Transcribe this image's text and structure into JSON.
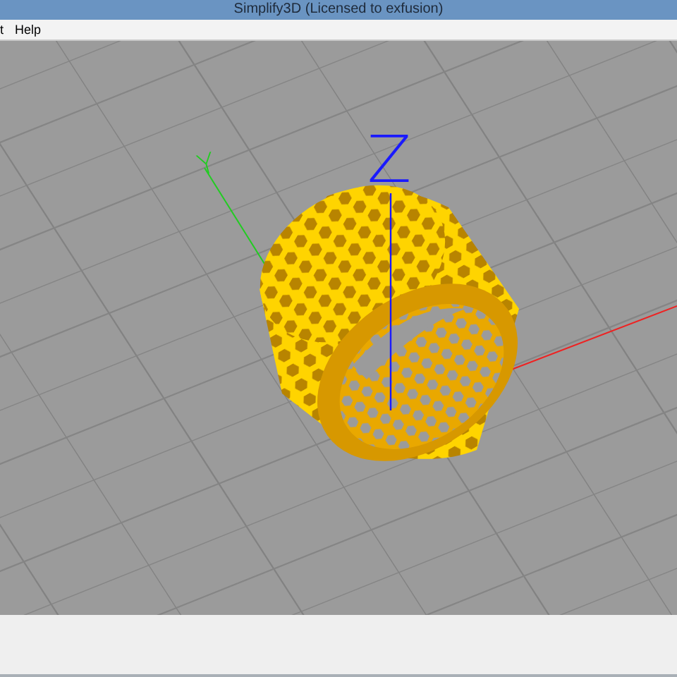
{
  "window": {
    "title": "Simplify3D (Licensed to exfusion)"
  },
  "menu": [
    "t",
    "Help"
  ],
  "viewport": {
    "axis_labels": [
      {
        "text": "Y",
        "color": "#22cc22"
      },
      {
        "text": "Z",
        "color": "#1a1aff"
      }
    ]
  }
}
